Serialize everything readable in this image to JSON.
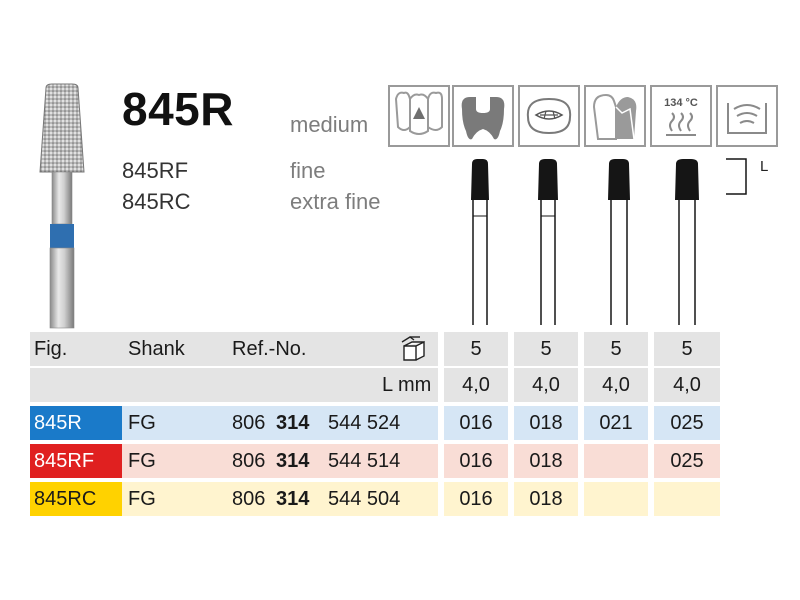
{
  "product": {
    "title": "845R",
    "grit": "medium",
    "variants": [
      {
        "code": "845RF",
        "grit": "fine"
      },
      {
        "code": "845RC",
        "grit": "extra fine"
      }
    ],
    "length_marker": "L"
  },
  "icons": [
    {
      "name": "anterior-teeth-icon"
    },
    {
      "name": "tooth-cavity-icon"
    },
    {
      "name": "tooth-crown-occlusal-icon"
    },
    {
      "name": "tooth-crown-prep-icon"
    },
    {
      "name": "sterilization-icon",
      "label": "134 °C"
    },
    {
      "name": "ultrasonic-bath-icon"
    }
  ],
  "table": {
    "headers": {
      "fig": "Fig.",
      "shank": "Shank",
      "ref": "Ref.-No.",
      "package_icon": "package-icon"
    },
    "package_qty": [
      "5",
      "5",
      "5",
      "5"
    ],
    "length_label": "L mm",
    "lengths": [
      "4,0",
      "4,0",
      "4,0",
      "4,0"
    ],
    "rows": [
      {
        "fig": "845R",
        "fig_color": "#1a7ac9",
        "shank": "FG",
        "ref_a": "806",
        "ref_b": "314",
        "ref_c": "544 524",
        "row_bg": "#d6e6f5",
        "sizes": [
          "016",
          "018",
          "021",
          "025"
        ]
      },
      {
        "fig": "845RF",
        "fig_color": "#e02020",
        "shank": "FG",
        "ref_a": "806",
        "ref_b": "314",
        "ref_c": "544 514",
        "row_bg": "#f9ddd6",
        "sizes": [
          "016",
          "018",
          "",
          "025"
        ]
      },
      {
        "fig": "845RC",
        "fig_color": "#ffd200",
        "shank": "FG",
        "ref_a": "806",
        "ref_b": "314",
        "ref_c": "544 504",
        "row_bg": "#fff4cf",
        "sizes": [
          "016",
          "018",
          "",
          ""
        ]
      }
    ]
  },
  "colors": {
    "header_bg": "#e4e4e4",
    "icon_border": "#9a9a9a",
    "ring_blue": "#2f6fb0"
  }
}
